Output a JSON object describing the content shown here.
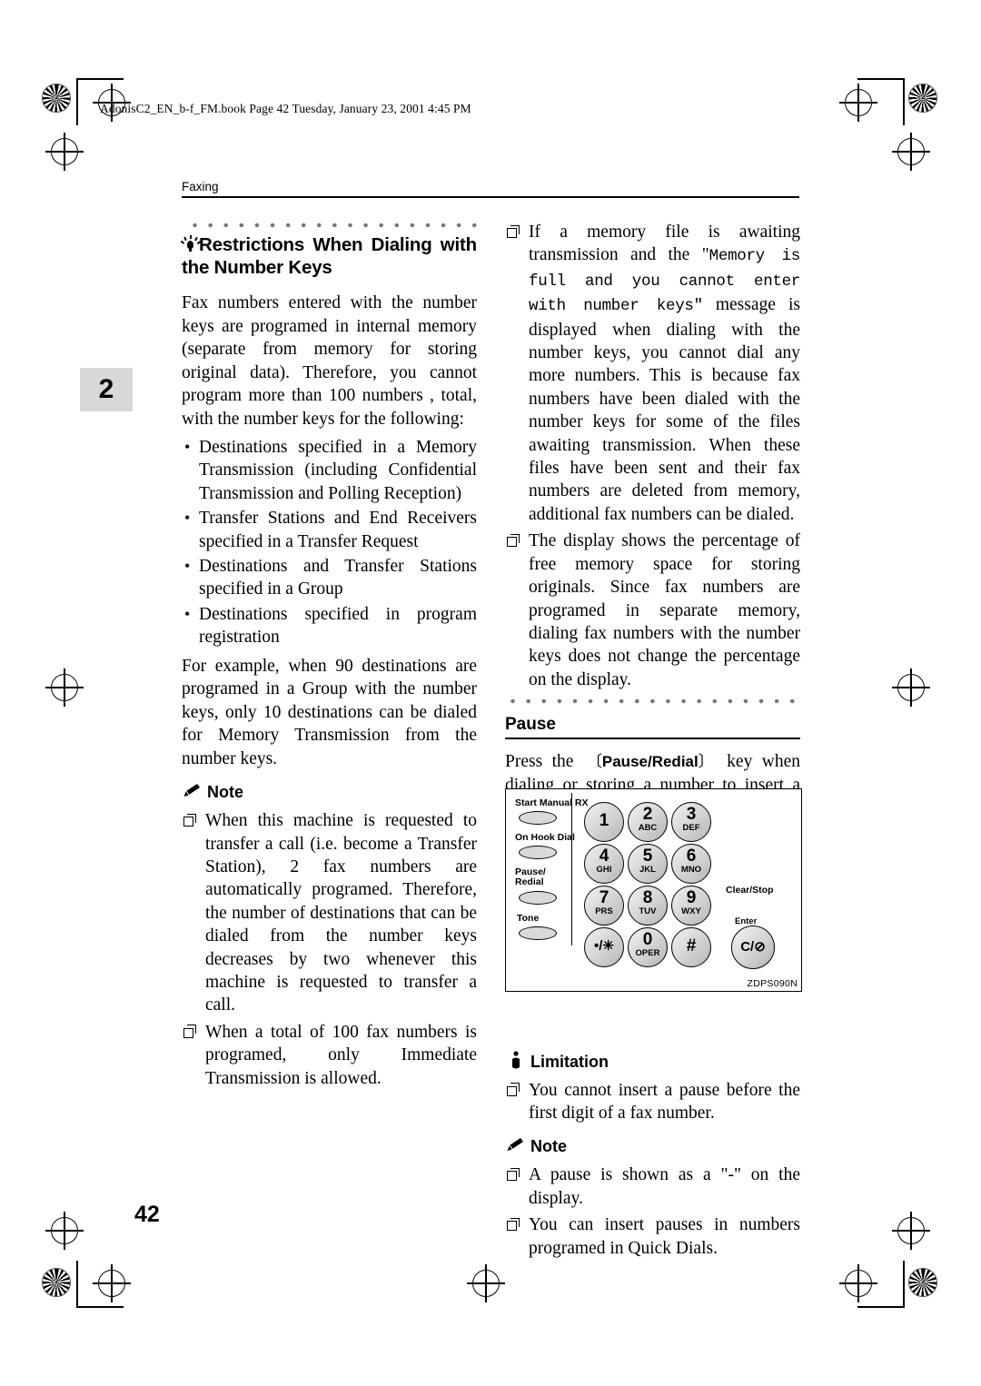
{
  "header": {
    "book_line": "AdonisC2_EN_b-f_FM.book  Page 42  Tuesday, January 23, 2001  4:45 PM",
    "running_head": "Faxing",
    "chapter_tab": "2",
    "page_number": "42"
  },
  "left_column": {
    "section_title": "Restrictions When Dialing with the Number Keys",
    "p1": "Fax numbers entered with the number keys are programed in internal memory (separate from memory for storing original data). Therefore, you cannot program more than 100 numbers , total, with the number keys for the following:",
    "bullets": [
      "Destinations specified in a Memory Transmission (including Confidential Transmission and Polling Reception)",
      "Transfer Stations and End Receivers specified in a Transfer Request",
      "Destinations and Transfer Stations specified in a Group",
      "Destinations specified in program registration"
    ],
    "p2": "For example, when 90 destinations are programed in a Group with the number keys, only 10 destinations can be dialed for Memory Transmission from the number keys.",
    "note_label": "Note",
    "notes": [
      "When this machine is requested to transfer a call (i.e. become a Transfer Station), 2 fax numbers are automatically programed. Therefore, the number of destinations that can be dialed from the number keys decreases by two whenever this machine is requested to transfer a call.",
      "When a total of 100 fax numbers is programed, only Immediate Transmission is allowed."
    ]
  },
  "right_column": {
    "item1_part1": "If a memory file is awaiting transmission and the \"",
    "item1_mono": "Memory is full and you cannot enter with number keys\"",
    "item1_part2": " message is displayed when dialing with the number keys, you cannot dial any more numbers. This is because fax numbers have been dialed with the number keys for some of the files awaiting transmission. When these files have been sent and their fax numbers are deleted from memory, additional fax numbers can be dialed.",
    "item2": "The display shows the percentage of free memory space for storing originals. Since fax numbers are programed in separate memory, dialing fax numbers with the number keys does not change the percentage on the display.",
    "pause_heading": "Pause",
    "pause_text_before": "Press the",
    "pause_key_label": "Pause/Redial",
    "pause_text_after": "key when dialing or storing a number to insert a pause of about two seconds.",
    "limitation_label": "Limitation",
    "limitations": [
      "You cannot insert a pause before the first digit of a fax number."
    ],
    "note_label": "Note",
    "notes": [
      "A pause is shown as a \"-\" on the display.",
      "You can insert pauses in numbers programed in Quick Dials."
    ]
  },
  "figure": {
    "code": "ZDPS090N",
    "labels": {
      "start_manual_rx": "Start Manual RX",
      "on_hook_dial": "On Hook Dial",
      "pause_redial_line1": "Pause/",
      "pause_redial_line2": "Redial",
      "tone": "Tone",
      "clear_stop": "Clear/Stop",
      "enter": "Enter",
      "clear_glyph": "C/⊘"
    },
    "keys": [
      {
        "big": "1",
        "sub": ""
      },
      {
        "big": "2",
        "sub": "ABC"
      },
      {
        "big": "3",
        "sub": "DEF"
      },
      {
        "big": "4",
        "sub": "GHI"
      },
      {
        "big": "5",
        "sub": "JKL"
      },
      {
        "big": "6",
        "sub": "MNO"
      },
      {
        "big": "7",
        "sub": "PRS"
      },
      {
        "big": "8",
        "sub": "TUV"
      },
      {
        "big": "9",
        "sub": "WXY"
      },
      {
        "big": "•/✳",
        "sub": ""
      },
      {
        "big": "0",
        "sub": "OPER"
      },
      {
        "big": "#",
        "sub": ""
      }
    ]
  }
}
